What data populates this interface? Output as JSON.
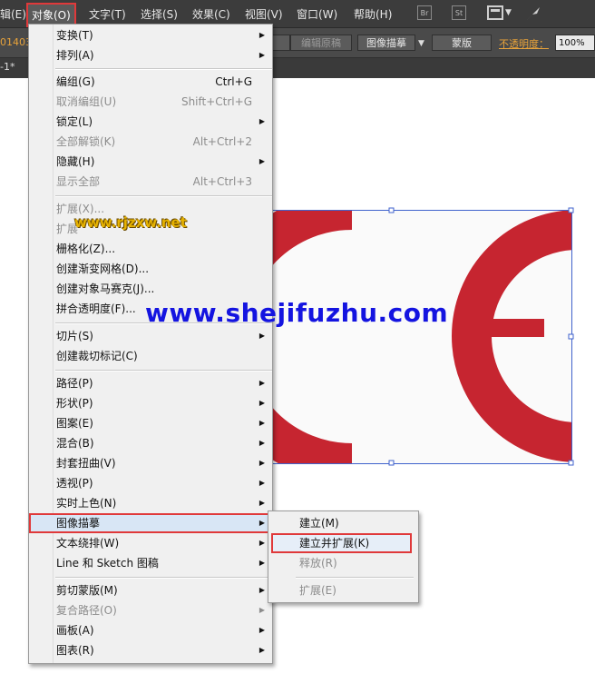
{
  "menubar": {
    "items": [
      {
        "label": "辑(E)"
      },
      {
        "label": "对象(O)"
      },
      {
        "label": "文字(T)"
      },
      {
        "label": "选择(S)"
      },
      {
        "label": "效果(C)"
      },
      {
        "label": "视图(V)"
      },
      {
        "label": "窗口(W)"
      },
      {
        "label": "帮助(H)"
      }
    ],
    "app_buttons": [
      "Br",
      "St"
    ]
  },
  "controlbar": {
    "left_id": "01403",
    "edit_original_label": "编辑原稿",
    "image_trace_label": "图像描摹",
    "mask_label": "蒙版",
    "opacity_label": "不透明度：",
    "opacity_value": "100%"
  },
  "tab": {
    "doc_label": "-1*"
  },
  "watermarks": {
    "small": "www.rjzxw.net",
    "large": "www.shejifuzhu.com"
  },
  "object_menu": {
    "items": [
      {
        "label": "变换(T)"
      },
      {
        "label": "排列(A)"
      },
      {
        "label": "编组(G)",
        "shortcut": "Ctrl+G"
      },
      {
        "label": "取消编组(U)",
        "shortcut": "Shift+Ctrl+G"
      },
      {
        "label": "锁定(L)"
      },
      {
        "label": "全部解锁(K)",
        "shortcut": "Alt+Ctrl+2"
      },
      {
        "label": "隐藏(H)"
      },
      {
        "label": "显示全部",
        "shortcut": "Alt+Ctrl+3"
      },
      {
        "label": "扩展(X)..."
      },
      {
        "label": "扩展"
      },
      {
        "label": "栅格化(Z)..."
      },
      {
        "label": "创建渐变网格(D)..."
      },
      {
        "label": "创建对象马赛克(J)..."
      },
      {
        "label": "拼合透明度(F)..."
      },
      {
        "label": "切片(S)"
      },
      {
        "label": "创建裁切标记(C)"
      },
      {
        "label": "路径(P)"
      },
      {
        "label": "形状(P)"
      },
      {
        "label": "图案(E)"
      },
      {
        "label": "混合(B)"
      },
      {
        "label": "封套扭曲(V)"
      },
      {
        "label": "透视(P)"
      },
      {
        "label": "实时上色(N)"
      },
      {
        "label": "图像描摹"
      },
      {
        "label": "文本绕排(W)"
      },
      {
        "label": "Line 和 Sketch 图稿"
      },
      {
        "label": "剪切蒙版(M)"
      },
      {
        "label": "复合路径(O)"
      },
      {
        "label": "画板(A)"
      },
      {
        "label": "图表(R)"
      }
    ]
  },
  "trace_submenu": {
    "items": [
      {
        "label": "建立(M)"
      },
      {
        "label": "建立并扩展(K)"
      },
      {
        "label": "释放(R)"
      },
      {
        "label": "扩展(E)"
      }
    ]
  },
  "colors": {
    "accent_red": "#e0393a",
    "logo_red": "#c62530",
    "selection_blue": "#3f62cc"
  }
}
